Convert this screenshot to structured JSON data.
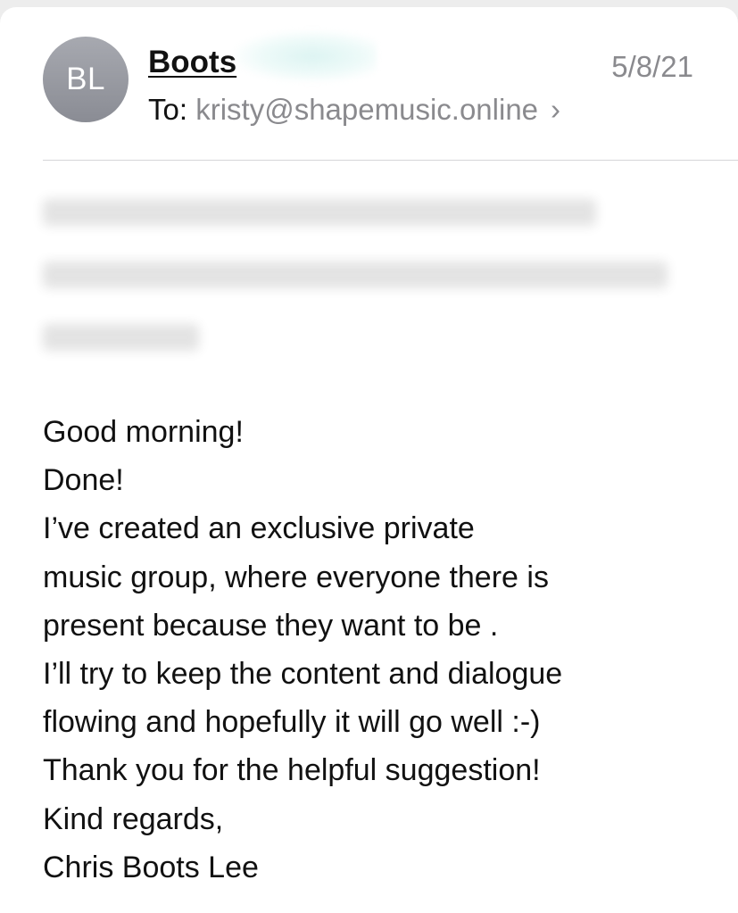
{
  "message": {
    "avatar_initials": "BL",
    "sender_name": "Boots",
    "date": "5/8/21",
    "to_label": "To:",
    "to_address": "kristy@shapemusic.online",
    "chevron": "›",
    "body_lines": [
      "Good morning!",
      "Done!",
      "I’ve created an exclusive private",
      "music group, where everyone there is",
      "present because they want to be .",
      "I’ll try to keep the content and dialogue",
      "flowing and hopefully it will go well :-)",
      "Thank you for the helpful suggestion!",
      "Kind regards,",
      "Chris Boots Lee"
    ]
  },
  "colors": {
    "avatar": "#9a9ca3",
    "secondary_text": "#8a8a8e",
    "primary_text": "#111111",
    "divider": "#d6d6d8"
  }
}
